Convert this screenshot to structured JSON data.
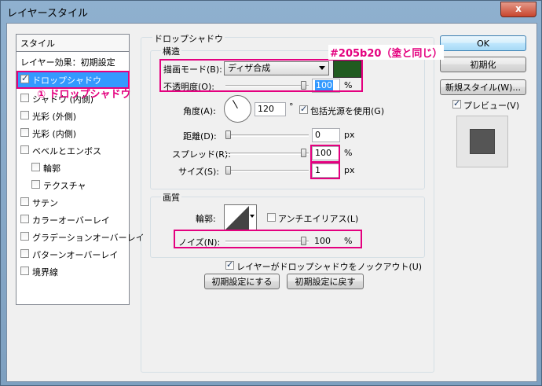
{
  "window": {
    "title": "レイヤースタイル",
    "close_glyph": "x"
  },
  "left_panel": {
    "header": "スタイル",
    "items": [
      {
        "label": "レイヤー効果：初期設定",
        "checkbox": false,
        "checked": false
      },
      {
        "label": "ドロップシャドウ",
        "checkbox": true,
        "checked": true,
        "selected": true
      },
      {
        "label": "シャドウ (内側)",
        "checkbox": true,
        "checked": false
      },
      {
        "label": "光彩 (外側)",
        "checkbox": true,
        "checked": false
      },
      {
        "label": "光彩 (内側)",
        "checkbox": true,
        "checked": false
      },
      {
        "label": "ベベルとエンボス",
        "checkbox": true,
        "checked": false
      },
      {
        "label": "輪郭",
        "checkbox": true,
        "checked": false,
        "indent": true
      },
      {
        "label": "テクスチャ",
        "checkbox": true,
        "checked": false,
        "indent": true
      },
      {
        "label": "サテン",
        "checkbox": true,
        "checked": false
      },
      {
        "label": "カラーオーバーレイ",
        "checkbox": true,
        "checked": false
      },
      {
        "label": "グラデーションオーバーレイ",
        "checkbox": true,
        "checked": false
      },
      {
        "label": "パターンオーバーレイ",
        "checkbox": true,
        "checked": false
      },
      {
        "label": "境界線",
        "checkbox": true,
        "checked": false
      }
    ]
  },
  "drop_shadow": {
    "group_title": "ドロップシャドウ",
    "structure": {
      "title": "構造",
      "blend_mode_label": "描画モード(B):",
      "blend_mode_value": "ディザ合成",
      "shadow_color": "#205b20",
      "opacity_label": "不透明度(O):",
      "opacity_value": "100",
      "opacity_fraction": 1.0,
      "angle_label": "角度(A):",
      "angle_value": "120",
      "angle_unit": "°",
      "global_light_label": "包括光源を使用(G)",
      "global_light_checked": true,
      "distance_label": "距離(D):",
      "distance_value": "0",
      "distance_fraction": 0.0,
      "spread_label": "スプレッド(R):",
      "spread_value": "100",
      "spread_fraction": 1.0,
      "size_label": "サイズ(S):",
      "size_value": "1",
      "size_fraction": 0.0,
      "percent": "%",
      "px": "px"
    },
    "quality": {
      "title": "画質",
      "contour_label": "輪郭:",
      "antialias_label": "アンチエイリアス(L)",
      "antialias_checked": false,
      "noise_label": "ノイズ(N):",
      "noise_value": "100",
      "noise_fraction": 1.0,
      "percent": "%"
    },
    "knockout_label": "レイヤーがドロップシャドウをノックアウト(U)",
    "knockout_checked": true,
    "make_default": "初期設定にする",
    "reset_default": "初期設定に戻す"
  },
  "right": {
    "ok": "OK",
    "reset": "初期化",
    "new_style": "新規スタイル(W)...",
    "preview_label": "プレビュー(V)",
    "preview_checked": true
  },
  "annotations": {
    "step1": "① ドロップシャドウ",
    "color_note": "#205b20（塗と同じ）"
  }
}
